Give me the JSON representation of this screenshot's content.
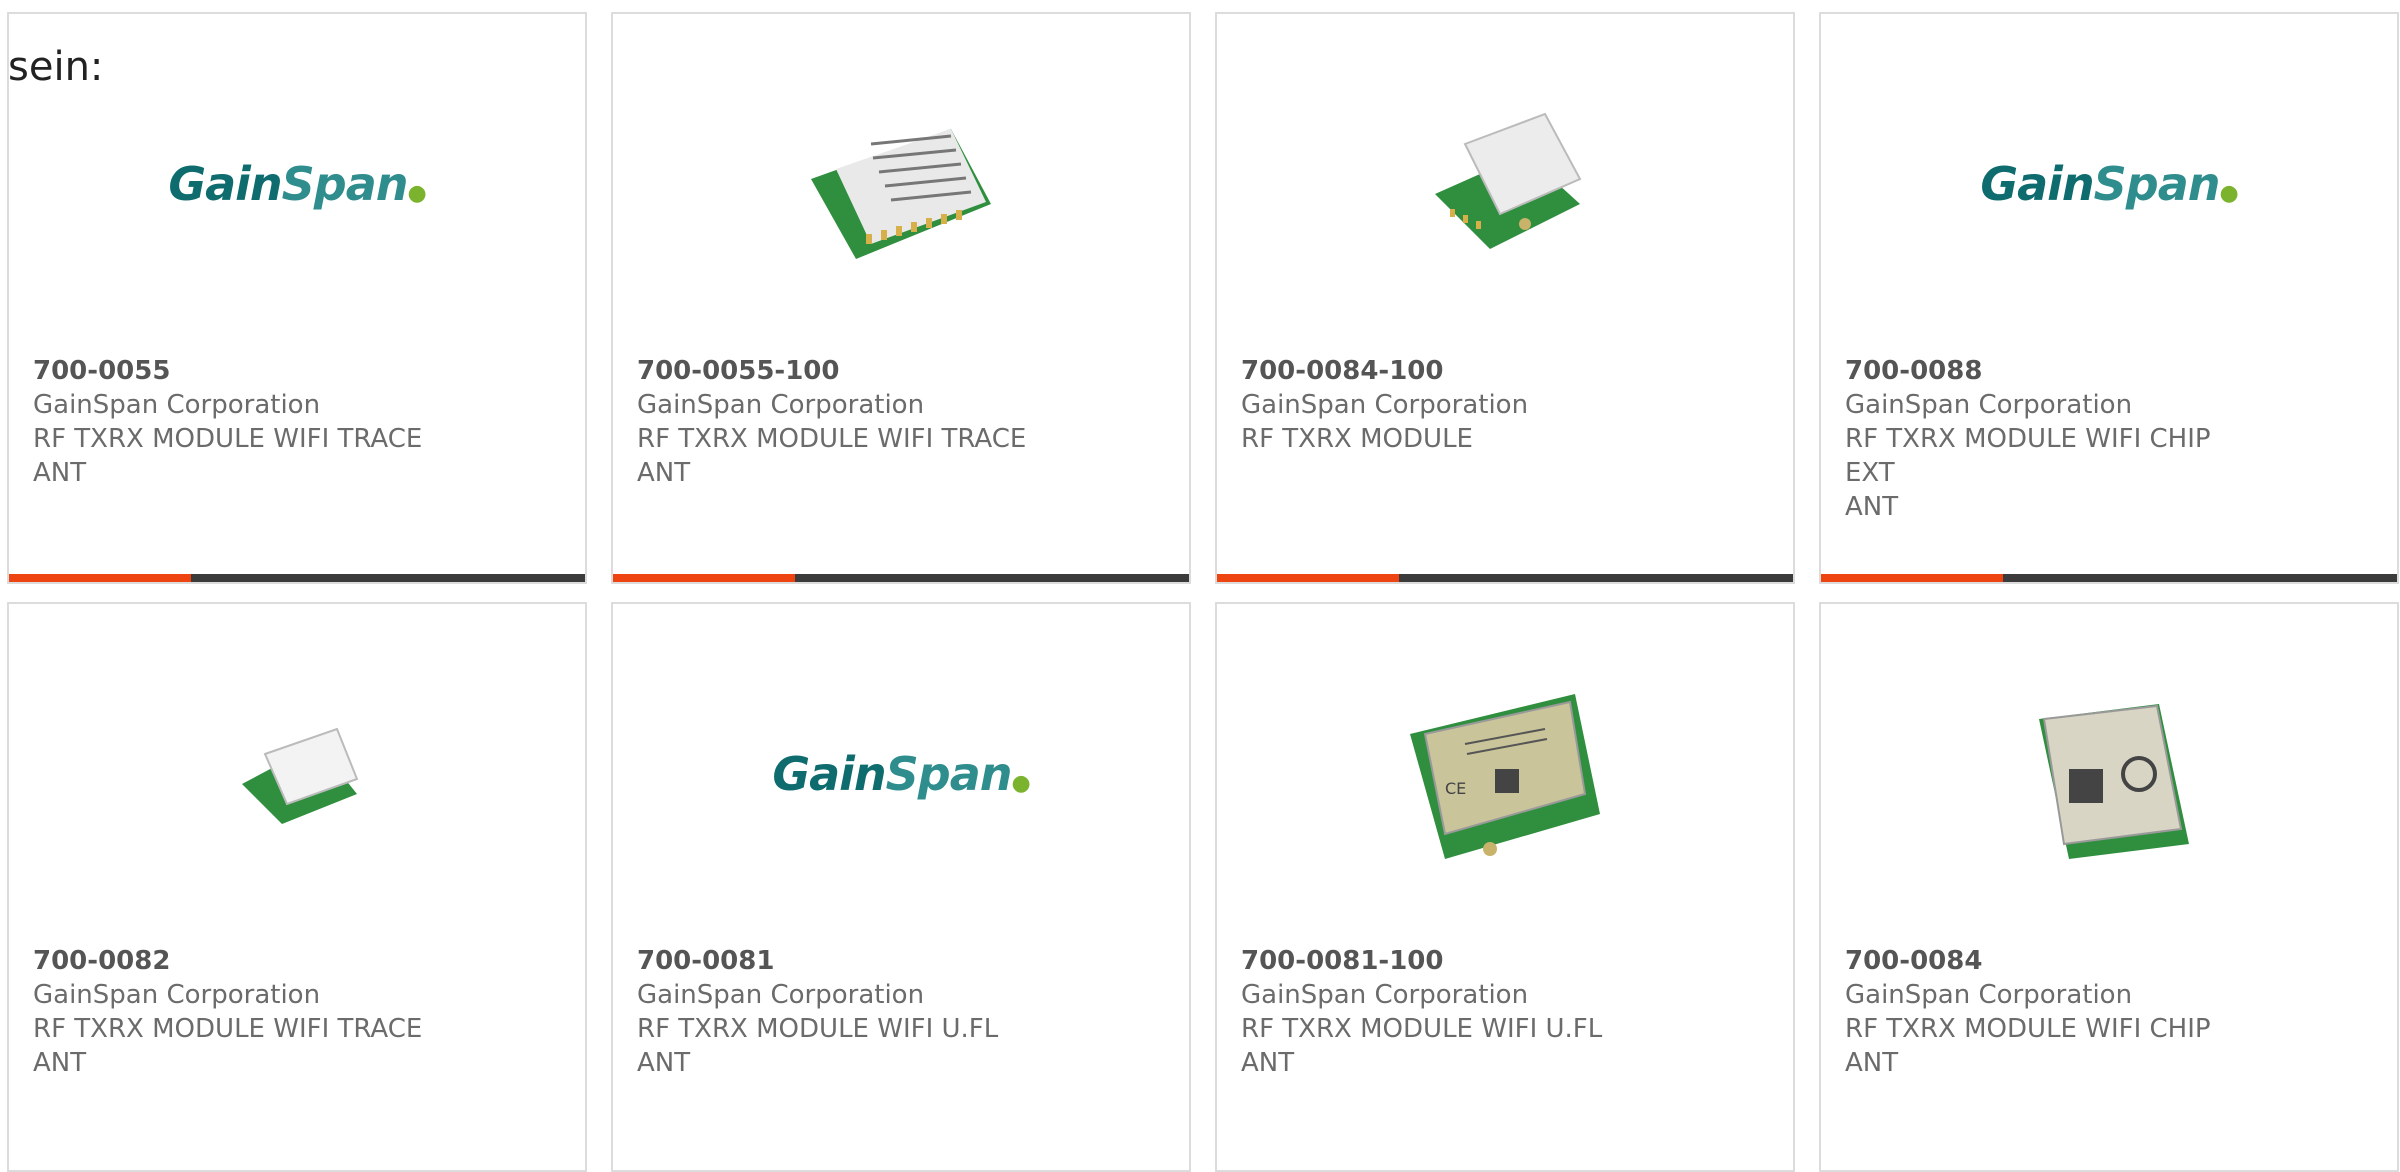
{
  "page": {
    "lead_text": "sein:"
  },
  "colors": {
    "accent": "#ee4411",
    "bar": "#3b3b3b",
    "logo_teal": "#0e6c6f",
    "logo_green": "#7bb32e"
  },
  "products": [
    {
      "part": "700-0055",
      "maker": "GainSpan Corporation",
      "desc1": "RF TXRX MODULE WIFI TRACE",
      "desc2": "ANT",
      "logo_text_a": "Gain",
      "logo_text_b": "Span"
    },
    {
      "part": "700-0055-100",
      "maker": "GainSpan Corporation",
      "desc1": "RF TXRX MODULE WIFI TRACE",
      "desc2": "ANT"
    },
    {
      "part": "700-0084-100",
      "maker": "GainSpan Corporation",
      "desc1": "RF TXRX MODULE",
      "desc2": ""
    },
    {
      "part": "700-0088",
      "maker": "GainSpan Corporation",
      "desc1": "RF TXRX MODULE WIFI CHIP EXT",
      "desc2": "ANT",
      "logo_text_a": "Gain",
      "logo_text_b": "Span"
    },
    {
      "part": "700-0082",
      "maker": "GainSpan Corporation",
      "desc1": "RF TXRX MODULE WIFI TRACE",
      "desc2": "ANT"
    },
    {
      "part": "700-0081",
      "maker": "GainSpan Corporation",
      "desc1": "RF TXRX MODULE WIFI U.FL ANT",
      "desc2": "",
      "logo_text_a": "Gain",
      "logo_text_b": "Span"
    },
    {
      "part": "700-0081-100",
      "maker": "GainSpan Corporation",
      "desc1": "RF TXRX MODULE WIFI U.FL ANT",
      "desc2": ""
    },
    {
      "part": "700-0084",
      "maker": "GainSpan Corporation",
      "desc1": "RF TXRX MODULE WIFI CHIP",
      "desc2": "ANT"
    }
  ]
}
